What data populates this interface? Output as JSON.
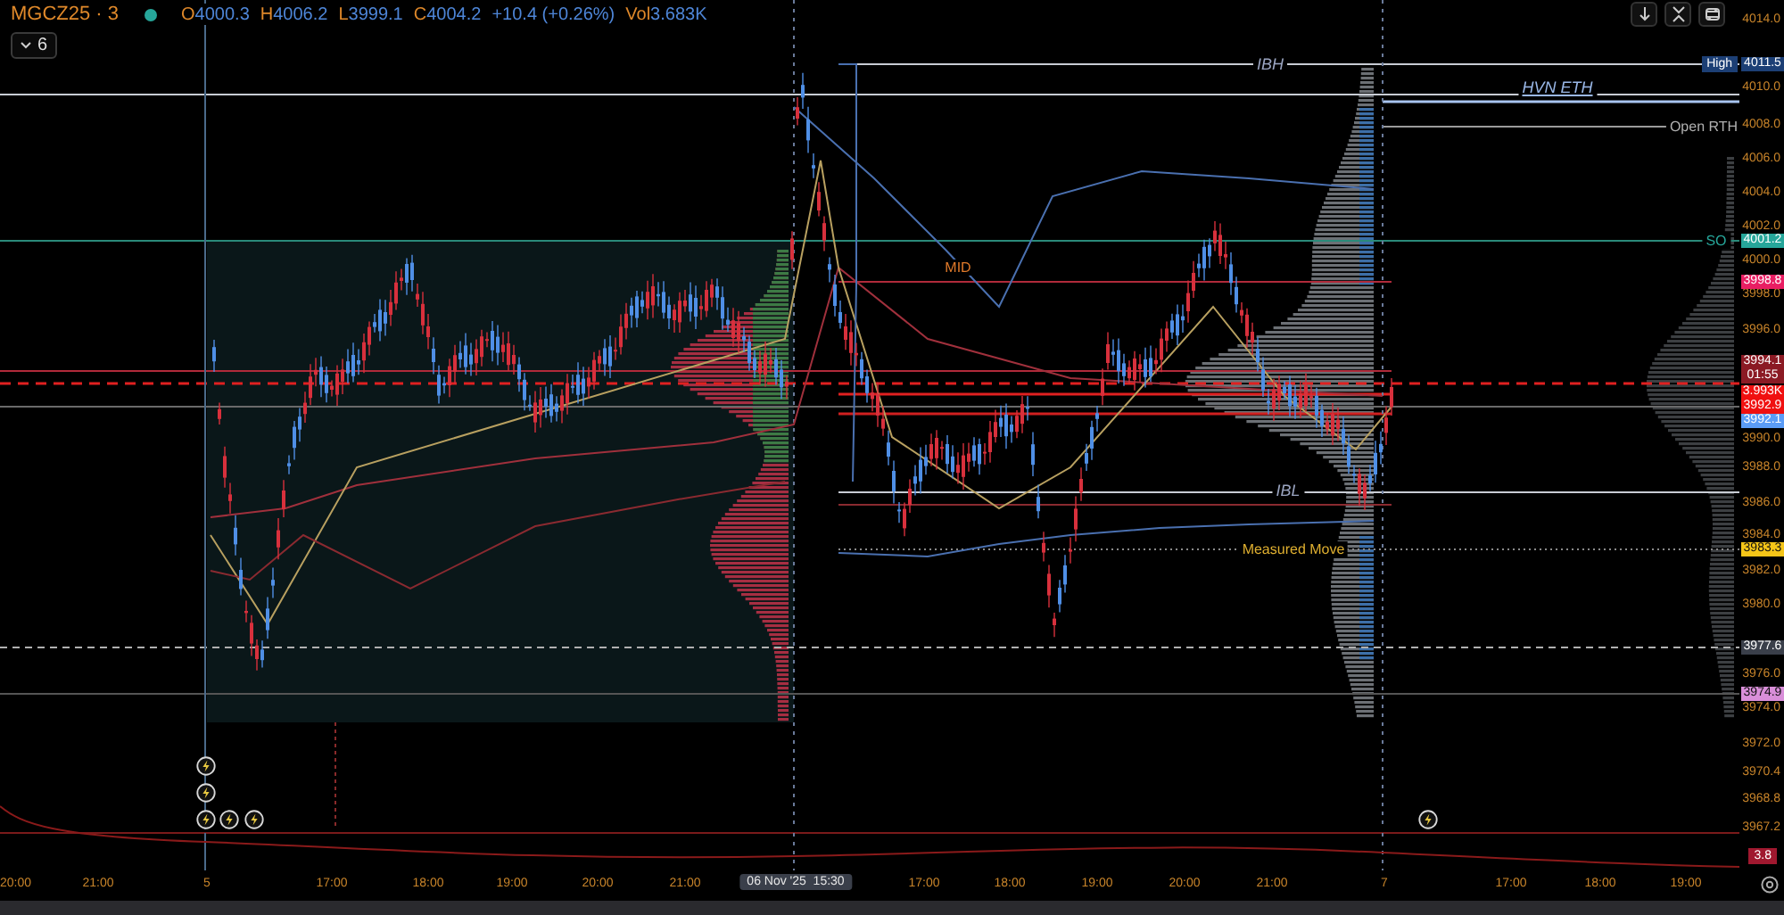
{
  "legend": {
    "symbol": "MGCZ25 · 3",
    "status": {
      "color": "#26a69a"
    },
    "ohlc": [
      {
        "label": "O",
        "value": "4000.3"
      },
      {
        "label": "H",
        "value": "4006.2"
      },
      {
        "label": "L",
        "value": "3999.1"
      },
      {
        "label": "C",
        "value": "4004.2"
      }
    ],
    "change": "+10.4 (+0.26%)",
    "volume_label": "Vol",
    "volume": "3.683K"
  },
  "indicators_button": {
    "count": "6"
  },
  "toolbar_buttons": [
    {
      "kind": "scroll-down"
    },
    {
      "kind": "collapse"
    },
    {
      "kind": "reset"
    }
  ],
  "chart_labels": [
    {
      "text": "IBH",
      "color": "#9aa4c0"
    },
    {
      "text": "HVN ETH",
      "color": "#9ab8e8"
    },
    {
      "text": "Open RTH",
      "color": "#b0b0b0"
    },
    {
      "text": "SO",
      "color": "#26a69a"
    },
    {
      "text": "MID",
      "color": "#e07a2a"
    },
    {
      "text": "IBL",
      "color": "#9aa4c0"
    },
    {
      "text": "Measured Move",
      "color": "#e0b030"
    }
  ],
  "price_axis": {
    "ticks": [
      "4014.0",
      "4010.0",
      "4008.0",
      "4006.0",
      "4004.0",
      "4002.0",
      "4000.0",
      "3998.0",
      "3996.0",
      "3990.0",
      "3988.0",
      "3986.0",
      "3984.0",
      "3982.0",
      "3980.0",
      "3976.0",
      "3974.0",
      "3972.0",
      "3970.4",
      "3968.8",
      "3967.2"
    ],
    "markers": [
      {
        "lines": [
          "4011.5"
        ],
        "tag": "High",
        "color": "#1c3f75"
      },
      {
        "lines": [
          "4001.2"
        ],
        "color": "#26a69a"
      },
      {
        "lines": [
          "3998.8"
        ],
        "color": "#e91e63"
      },
      {
        "lines": [
          "3994.1",
          "01:55"
        ],
        "color": "#8b1a24"
      },
      {
        "lines": [
          "3.993K",
          "3992.9"
        ],
        "color": "#f01010"
      },
      {
        "lines": [
          "3992.1"
        ],
        "color": "#5b9cf6"
      },
      {
        "lines": [
          "3983.3"
        ],
        "color": "#f5c518"
      },
      {
        "lines": [
          "3977.6"
        ],
        "color": "#3a3f4a"
      },
      {
        "lines": [
          "3974.9"
        ],
        "color": "#d98fd9"
      }
    ]
  },
  "volume_pane": {
    "reading": "3.8"
  },
  "time_axis": {
    "labels": [
      "20:00",
      "21:00",
      "5",
      "17:00",
      "18:00",
      "19:00",
      "20:00",
      "21:00",
      "17:00",
      "18:00",
      "19:00",
      "20:00",
      "21:00",
      "7",
      "17:00",
      "18:00",
      "19:00"
    ],
    "cursor_label": "06 Nov '25  15:30"
  }
}
